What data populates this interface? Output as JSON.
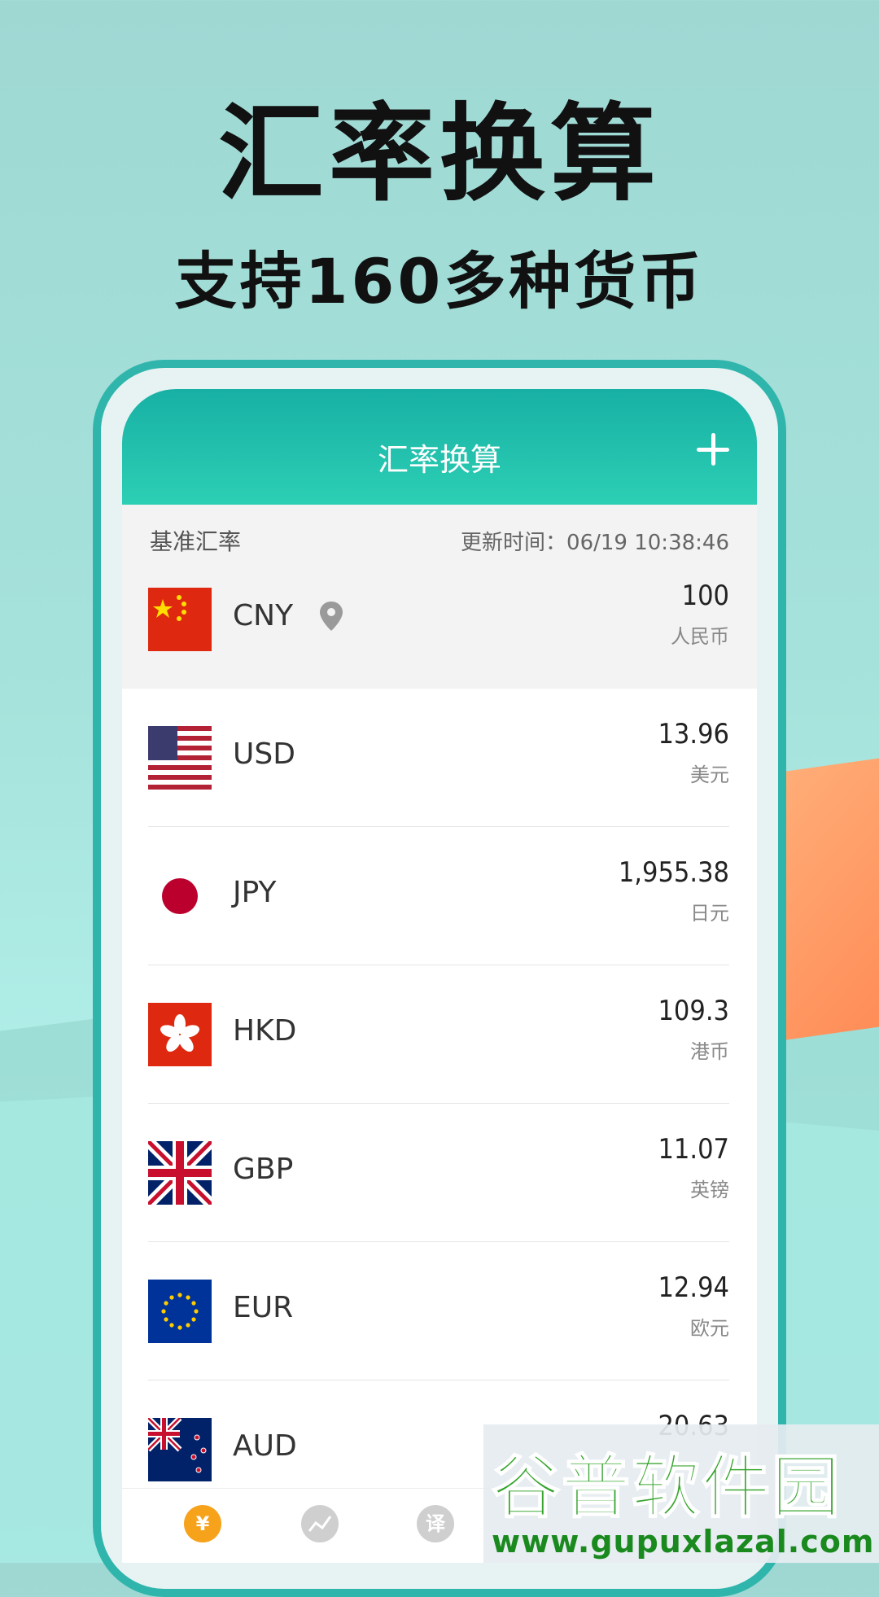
{
  "promo": {
    "title": "汇率换算",
    "subtitle": "支持160多种货币"
  },
  "appbar": {
    "title": "汇率换算",
    "add_icon": "plus-icon"
  },
  "base": {
    "label": "基准汇率",
    "update_time": "更新时间：06/19 10:38:46",
    "currency": {
      "code": "CNY",
      "value": "100",
      "name": "人民币",
      "location_icon": "location-pin-icon"
    }
  },
  "rates": [
    {
      "code": "USD",
      "value": "13.96",
      "name": "美元"
    },
    {
      "code": "JPY",
      "value": "1,955.38",
      "name": "日元"
    },
    {
      "code": "HKD",
      "value": "109.3",
      "name": "港币"
    },
    {
      "code": "GBP",
      "value": "11.07",
      "name": "英镑"
    },
    {
      "code": "EUR",
      "value": "12.94",
      "name": "欧元"
    },
    {
      "code": "AUD",
      "value": "20.63",
      "name": ""
    }
  ],
  "tabs": [
    {
      "icon": "exchange-icon",
      "label": "¥",
      "color": "#f7a21b"
    },
    {
      "icon": "chart-icon",
      "label": "",
      "color": "#c9c9c9"
    },
    {
      "icon": "translate-icon",
      "label": "译",
      "color": "#c9c9c9"
    }
  ],
  "watermark": {
    "logo": "谷普软件园",
    "url": "www.gupuxlazal.com"
  },
  "colors": {
    "accent": "#19b3a7",
    "phone_border": "#2fb5ac",
    "background": "#a6e3dc"
  }
}
